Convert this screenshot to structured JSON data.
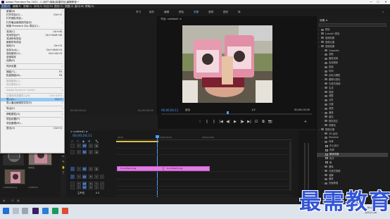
{
  "window": {
    "title": "Adobe Premiere Pro 2020 - C:\\用户\\电脑\\新建项目\\最需教育 *",
    "controls": [
      "—",
      "☐",
      "✕"
    ]
  },
  "menubar": {
    "items": [
      "文件(F)",
      "编辑(E)",
      "剪辑(C)",
      "序列(S)",
      "标记(M)",
      "图形(G)",
      "视图(V)",
      "窗口(W)",
      "帮助(H)"
    ],
    "active_index": 0
  },
  "workspace": {
    "tabs": [
      "学习",
      "组件",
      "编辑",
      "颜色",
      "效果",
      "音频",
      "图形",
      "库"
    ],
    "active_index": 4
  },
  "file_menu": {
    "rows": [
      {
        "label": "新建(N)",
        "shortcut": "",
        "submenu": true,
        "disabled": false
      },
      {
        "label": "打开项目(O)...",
        "shortcut": "Ctrl+O",
        "submenu": false,
        "disabled": false
      },
      {
        "label": "打开团队项目...",
        "shortcut": "",
        "submenu": false,
        "disabled": false
      },
      {
        "label": "打开最近使用的内容(E)",
        "shortcut": "",
        "submenu": true,
        "disabled": false
      },
      {
        "label": "转换 Premiere Clip 项目(C)...",
        "shortcut": "",
        "submenu": false,
        "disabled": false
      },
      {
        "sep": true
      },
      {
        "label": "关闭(C)",
        "shortcut": "Ctrl+W",
        "submenu": false,
        "disabled": false
      },
      {
        "label": "关闭项目(P)",
        "shortcut": "Ctrl+Shift+W",
        "submenu": false,
        "disabled": false
      },
      {
        "label": "关闭所有项目",
        "shortcut": "",
        "submenu": false,
        "disabled": false
      },
      {
        "label": "刷新所有项目",
        "shortcut": "",
        "submenu": false,
        "disabled": false
      },
      {
        "label": "保存(S)",
        "shortcut": "Ctrl+S",
        "submenu": false,
        "disabled": false
      },
      {
        "label": "另存为(A)...",
        "shortcut": "Ctrl+Shift+S",
        "submenu": false,
        "disabled": false
      },
      {
        "label": "保存副本(Y)...",
        "shortcut": "Ctrl+Alt+S",
        "submenu": false,
        "disabled": false
      },
      {
        "label": "全部保存",
        "shortcut": "",
        "submenu": false,
        "disabled": false
      },
      {
        "label": "还原(R)",
        "shortcut": "",
        "submenu": false,
        "disabled": false
      },
      {
        "sep": true
      },
      {
        "label": "同步设置",
        "shortcut": "",
        "submenu": true,
        "disabled": false
      },
      {
        "sep": true
      },
      {
        "label": "捕捉(T)...",
        "shortcut": "F5",
        "submenu": false,
        "disabled": false
      },
      {
        "label": "批量捕捉(B)...",
        "shortcut": "F6",
        "submenu": false,
        "disabled": false
      },
      {
        "sep": true
      },
      {
        "label": "链接媒体(L)...",
        "shortcut": "",
        "submenu": false,
        "disabled": true
      },
      {
        "label": "设为脱机(O)...",
        "shortcut": "",
        "submenu": false,
        "disabled": true
      },
      {
        "sep": true
      },
      {
        "label": "Adobe Dynamic Link(K)",
        "shortcut": "",
        "submenu": true,
        "disabled": true
      },
      {
        "sep": true
      },
      {
        "label": "从媒体浏览器导入(M)",
        "shortcut": "Ctrl+Alt+I",
        "submenu": false,
        "disabled": true
      },
      {
        "label": "导入(I)...",
        "shortcut": "Ctrl+I",
        "submenu": false,
        "disabled": false,
        "highlight": true
      },
      {
        "label": "导入最近使用的文件(F)",
        "shortcut": "",
        "submenu": true,
        "disabled": false
      },
      {
        "sep": true
      },
      {
        "label": "导出(E)",
        "shortcut": "",
        "submenu": true,
        "disabled": false
      },
      {
        "sep": true
      },
      {
        "label": "获取属性(G)",
        "shortcut": "",
        "submenu": true,
        "disabled": false
      },
      {
        "sep": true
      },
      {
        "label": "项目设置(P)",
        "shortcut": "",
        "submenu": true,
        "disabled": false
      },
      {
        "label": "项目管理(M)...",
        "shortcut": "",
        "submenu": false,
        "disabled": false
      },
      {
        "sep": true
      },
      {
        "label": "退出(X)",
        "shortcut": "Ctrl+Q",
        "submenu": false,
        "disabled": false
      }
    ]
  },
  "source_monitor": {
    "time_left": "00;00;00;00",
    "time_right": "00;00;00;00"
  },
  "program_monitor": {
    "tab": "节目: untitled1 ≡",
    "timecode": "00;00;04;11",
    "fit": "适合",
    "ratio": "1/2",
    "duration": "00;00;10;00",
    "playhead_fraction": 0.44,
    "transport": [
      "⧘",
      "{",
      "}",
      "|◀",
      "◀|",
      "▶",
      "|▶",
      "▶|",
      "⊡",
      "⧉",
      "📷",
      "+"
    ]
  },
  "effects_panel": {
    "title": "效果 ≡",
    "rows": [
      {
        "label": "预设",
        "level": 0,
        "open": false
      },
      {
        "label": "Lumetri 预设",
        "level": 0,
        "open": false
      },
      {
        "label": "音频效果",
        "level": 0,
        "open": false
      },
      {
        "label": "音频过渡",
        "level": 0,
        "open": false
      },
      {
        "label": "视频效果",
        "level": 0,
        "open": true
      },
      {
        "label": "Obsolete",
        "level": 1,
        "open": false
      },
      {
        "label": "变换",
        "level": 1,
        "open": false
      },
      {
        "label": "图像控制",
        "level": 1,
        "open": false
      },
      {
        "label": "实用程序",
        "level": 1,
        "open": false
      },
      {
        "label": "扭曲",
        "level": 1,
        "open": false
      },
      {
        "label": "时间",
        "level": 1,
        "open": false
      },
      {
        "label": "杂色与颗粒",
        "level": 1,
        "open": false
      },
      {
        "label": "模糊与锐化",
        "level": 1,
        "open": false
      },
      {
        "label": "沉浸式视频",
        "level": 1,
        "open": false
      },
      {
        "label": "生成",
        "level": 1,
        "open": false
      },
      {
        "label": "视频",
        "level": 1,
        "open": false
      },
      {
        "label": "调整",
        "level": 1,
        "open": false
      },
      {
        "label": "过时",
        "level": 1,
        "open": false
      },
      {
        "label": "过渡",
        "level": 1,
        "open": false
      },
      {
        "label": "透视",
        "level": 1,
        "open": false
      },
      {
        "label": "通道",
        "level": 1,
        "open": false
      },
      {
        "label": "键控",
        "level": 1,
        "open": false
      },
      {
        "label": "颜色校正",
        "level": 1,
        "open": false
      },
      {
        "label": "风格化",
        "level": 1,
        "open": false
      },
      {
        "label": "视频过渡",
        "level": 0,
        "open": true
      },
      {
        "label": "3D 运动",
        "level": 1,
        "open": false
      },
      {
        "label": "Dissolve",
        "level": 1,
        "open": false
      },
      {
        "label": "内滑",
        "level": 1,
        "open": true
      },
      {
        "label": "中心拆分",
        "level": 2,
        "fx": true
      },
      {
        "label": "内滑",
        "level": 2,
        "fx": true
      },
      {
        "label": "带状内滑",
        "level": 2,
        "fx": true,
        "highlight": true
      },
      {
        "label": "拆分",
        "level": 2,
        "fx": true
      },
      {
        "label": "推",
        "level": 2,
        "fx": true
      },
      {
        "label": "擦除",
        "level": 1,
        "open": false
      },
      {
        "label": "沉浸式视频",
        "level": 1,
        "open": false
      },
      {
        "label": "溶解",
        "level": 1,
        "open": false
      },
      {
        "label": "缩放",
        "level": 1,
        "open": false
      },
      {
        "label": "页面剥落",
        "level": 1,
        "open": false
      }
    ]
  },
  "timeline": {
    "tab": "× untitled1 ≡",
    "timecode": "00;00;04;11",
    "ruler": [
      "00;00",
      "00;00;05;00",
      "00;00;10;00"
    ],
    "tracks": [
      {
        "name": "V3",
        "kind": "video"
      },
      {
        "name": "V2",
        "kind": "video"
      },
      {
        "name": "V1",
        "kind": "video"
      },
      {
        "name": "A1",
        "kind": "audio"
      },
      {
        "name": "A2",
        "kind": "audio"
      },
      {
        "name": "A3",
        "kind": "audio"
      },
      {
        "name": "主声道",
        "kind": "master"
      }
    ],
    "master_value": "0.0",
    "clips": [
      {
        "label": "fx untitled1.png",
        "track": "V1"
      },
      {
        "label": "fx untitled1.png",
        "track": "V1"
      }
    ]
  },
  "project_panel": {
    "items": [
      "",
      "未命名",
      "untitled2.png",
      "untitled1"
    ]
  },
  "taskbar": {
    "time": "18:28",
    "date": "2021/7/26"
  },
  "watermark": "最需教育",
  "colors": {
    "accent_blue": "#4f9bff",
    "clip_pink": "#e37ae6",
    "menu_highlight": "#91c9f7"
  }
}
